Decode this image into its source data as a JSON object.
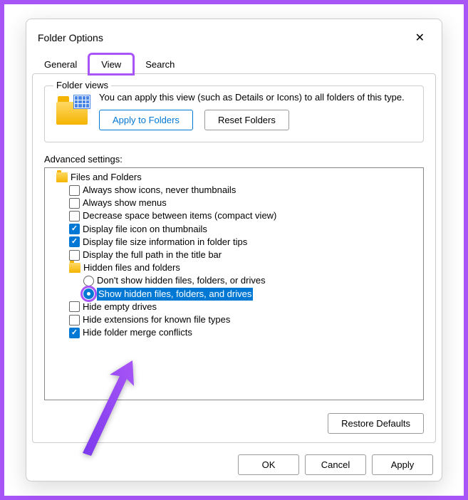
{
  "title": "Folder Options",
  "tabs": {
    "general": "General",
    "view": "View",
    "search": "Search"
  },
  "folder_views": {
    "legend": "Folder views",
    "description": "You can apply this view (such as Details or Icons) to all folders of this type.",
    "apply_btn": "Apply to Folders",
    "reset_btn": "Reset Folders"
  },
  "advanced": {
    "label": "Advanced settings:",
    "root": "Files and Folders",
    "items": {
      "always_icons": "Always show icons, never thumbnails",
      "always_menus": "Always show menus",
      "compact": "Decrease space between items (compact view)",
      "file_icon": "Display file icon on thumbnails",
      "file_size": "Display file size information in folder tips",
      "full_path": "Display the full path in the title bar",
      "hidden_group": "Hidden files and folders",
      "dont_show": "Don't show hidden files, folders, or drives",
      "show_hidden": "Show hidden files, folders, and drives",
      "hide_empty": "Hide empty drives",
      "hide_ext": "Hide extensions for known file types",
      "hide_merge": "Hide folder merge conflicts"
    }
  },
  "restore_btn": "Restore Defaults",
  "buttons": {
    "ok": "OK",
    "cancel": "Cancel",
    "apply": "Apply"
  }
}
